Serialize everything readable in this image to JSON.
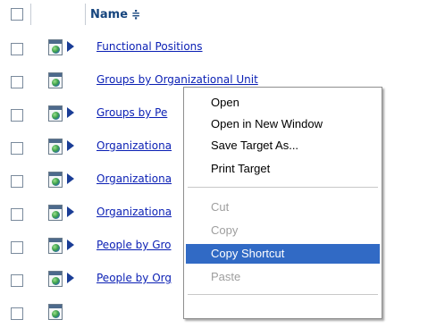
{
  "header": {
    "name_label": "Name",
    "sort_glyph": "≑"
  },
  "rows": [
    {
      "label": "Functional Positions",
      "expandable": true
    },
    {
      "label": "Groups by Organizational Unit",
      "expandable": false
    },
    {
      "label": "Groups by Pe",
      "expandable": true
    },
    {
      "label": "Organizationa",
      "expandable": true
    },
    {
      "label": "Organizationa",
      "expandable": true
    },
    {
      "label": "Organizationa",
      "expandable": true
    },
    {
      "label": "People by Gro",
      "expandable": true
    },
    {
      "label": "People by Org",
      "expandable": true
    },
    {
      "label": "",
      "expandable": false
    }
  ],
  "context_menu": {
    "items": [
      {
        "label": "Open",
        "state": "normal"
      },
      {
        "label": "Open in New Window",
        "state": "normal"
      },
      {
        "label": "Save Target As...",
        "state": "normal"
      },
      {
        "label": "Print Target",
        "state": "normal"
      },
      {
        "label": "Cut",
        "state": "disabled"
      },
      {
        "label": "Copy",
        "state": "disabled"
      },
      {
        "label": "Copy Shortcut",
        "state": "selected"
      },
      {
        "label": "Paste",
        "state": "disabled"
      }
    ]
  },
  "colors": {
    "link": "#0a1fb4",
    "header_text": "#16457e",
    "menu_highlight": "#316ac5"
  },
  "icons": {
    "row_icon": "report-document-icon",
    "expand_icon": "expand-arrow-icon"
  }
}
